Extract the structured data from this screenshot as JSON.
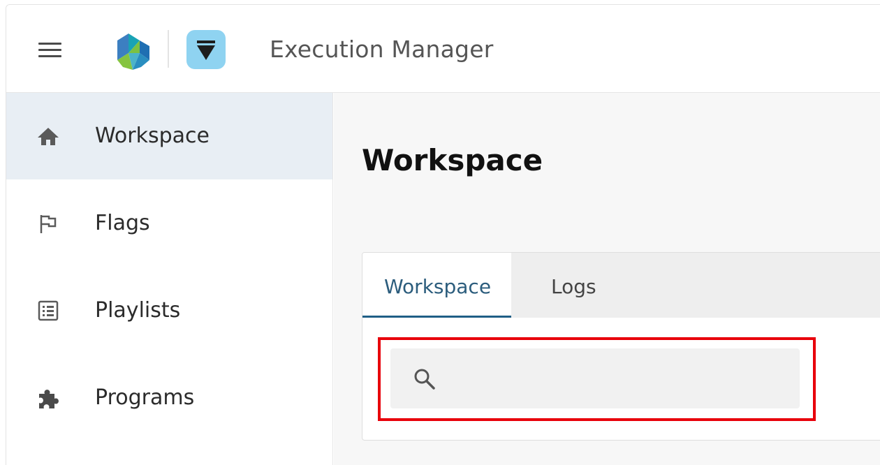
{
  "header": {
    "app_title": "Execution Manager",
    "menu_icon": "hamburger-menu-icon",
    "brand_logo": "hexagon-brand-logo",
    "app_icon": "execution-manager-app-icon",
    "app_icon_color": "#8fd3f1"
  },
  "sidebar": {
    "items": [
      {
        "label": "Workspace",
        "icon": "home-icon",
        "active": true
      },
      {
        "label": "Flags",
        "icon": "flag-icon",
        "active": false
      },
      {
        "label": "Playlists",
        "icon": "list-icon",
        "active": false
      },
      {
        "label": "Programs",
        "icon": "puzzle-piece-icon",
        "active": false
      }
    ],
    "active_background": "#e8eef4"
  },
  "main": {
    "page_title": "Workspace",
    "tabs": [
      {
        "label": "Workspace",
        "active": true
      },
      {
        "label": "Logs",
        "active": false
      }
    ],
    "search": {
      "value": "",
      "placeholder": "",
      "icon": "search-icon"
    },
    "accent_color": "#1f5f86",
    "highlight_color": "#e8000b"
  }
}
